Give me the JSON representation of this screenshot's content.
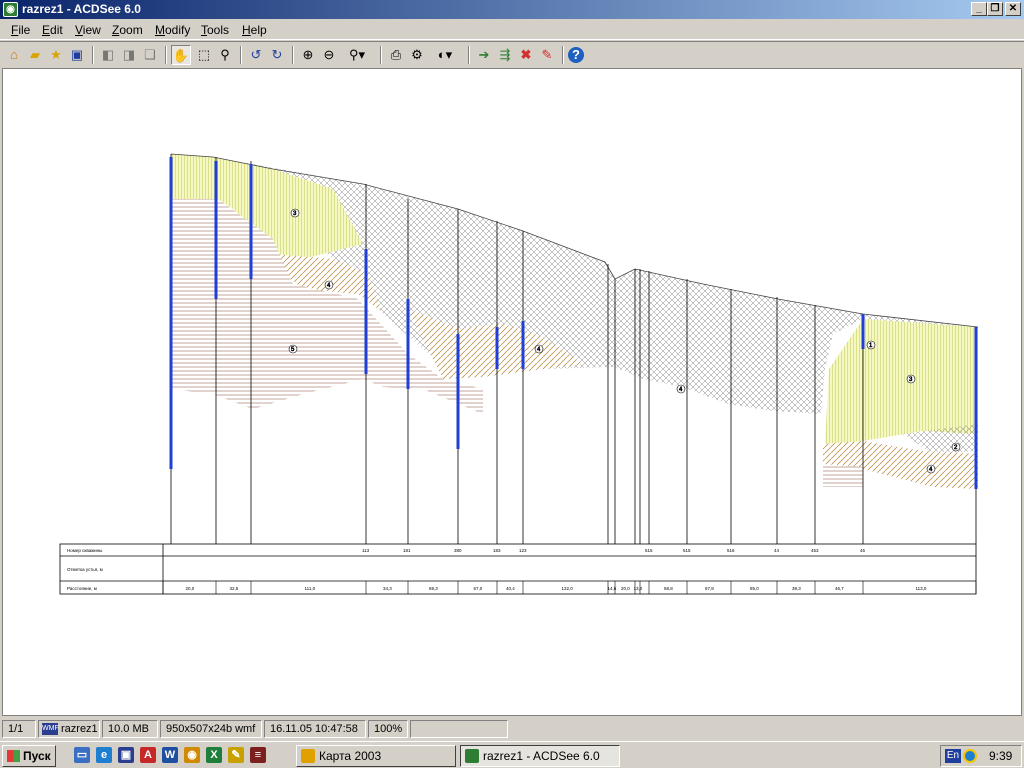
{
  "window": {
    "title": "razrez1 - ACDSee 6.0",
    "icon": "acdsee-icon",
    "controls": {
      "minimize": "_",
      "restore": "❐",
      "close": "✕"
    }
  },
  "menu": [
    {
      "label": "File",
      "key": "F"
    },
    {
      "label": "Edit",
      "key": "E"
    },
    {
      "label": "View",
      "key": "V"
    },
    {
      "label": "Zoom",
      "key": "Z"
    },
    {
      "label": "Modify",
      "key": "M"
    },
    {
      "label": "Tools",
      "key": "T"
    },
    {
      "label": "Help",
      "key": "H"
    }
  ],
  "toolbar": {
    "icons": [
      "browse-icon",
      "open-icon",
      "favorites-icon",
      "save-icon",
      "prev-image-icon",
      "next-image-icon",
      "copy-image-icon",
      "hand-tool-icon",
      "select-tool-icon",
      "zoom-tool-icon",
      "rotate-left-icon",
      "rotate-right-icon",
      "zoom-in-icon",
      "zoom-out-icon",
      "zoom-menu-icon",
      "print-icon",
      "properties-icon",
      "filter-icon",
      "move-to-icon",
      "copy-to-icon",
      "delete-icon",
      "edit-icon",
      "help-icon"
    ],
    "active": "hand-tool-icon"
  },
  "drawing": {
    "table_labels": [
      "Номер скважины",
      "Отметка устья, м",
      "Расстояние, м"
    ],
    "well_numbers": [
      "113",
      "181",
      "380",
      "183",
      "123",
      "515",
      "515",
      "516",
      "44",
      "453",
      "45"
    ],
    "distances": [
      "20,0",
      "32,5",
      "111,0",
      "34,3",
      "69,3",
      "57,0",
      "40,4",
      "122,0",
      "14,6",
      "20,0",
      "13,0",
      "58,8",
      "67,8",
      "85,0",
      "39,3",
      "46,7",
      "113,0"
    ],
    "unit_numbers": [
      "1",
      "2",
      "3",
      "4",
      "5"
    ]
  },
  "status": {
    "page": "1/1",
    "format": "WMF",
    "filename": "razrez1",
    "size": "10.0 MB",
    "dimensions": "950x507x24b wmf",
    "modified": "16.11.05 10:47:58",
    "zoom": "100%"
  },
  "taskbar": {
    "start": "Пуск",
    "quicklaunch": [
      "show-desktop-icon",
      "ie-icon",
      "save-disk-icon",
      "acrobat-icon",
      "word-icon",
      "winamp-icon",
      "excel-icon",
      "pencil-icon",
      "books-icon"
    ],
    "tasks": [
      {
        "label": "Карта 2003",
        "active": false
      },
      {
        "label": "razrez1 - ACDSee 6.0",
        "active": true
      }
    ],
    "lang": "En",
    "clock": "9:39"
  },
  "colors": {
    "titlebar": "#0a246a",
    "loam": "#f2f7b0",
    "clay": "#c8a15a",
    "sand": "#a6784a",
    "well": "#1f3fd6"
  }
}
